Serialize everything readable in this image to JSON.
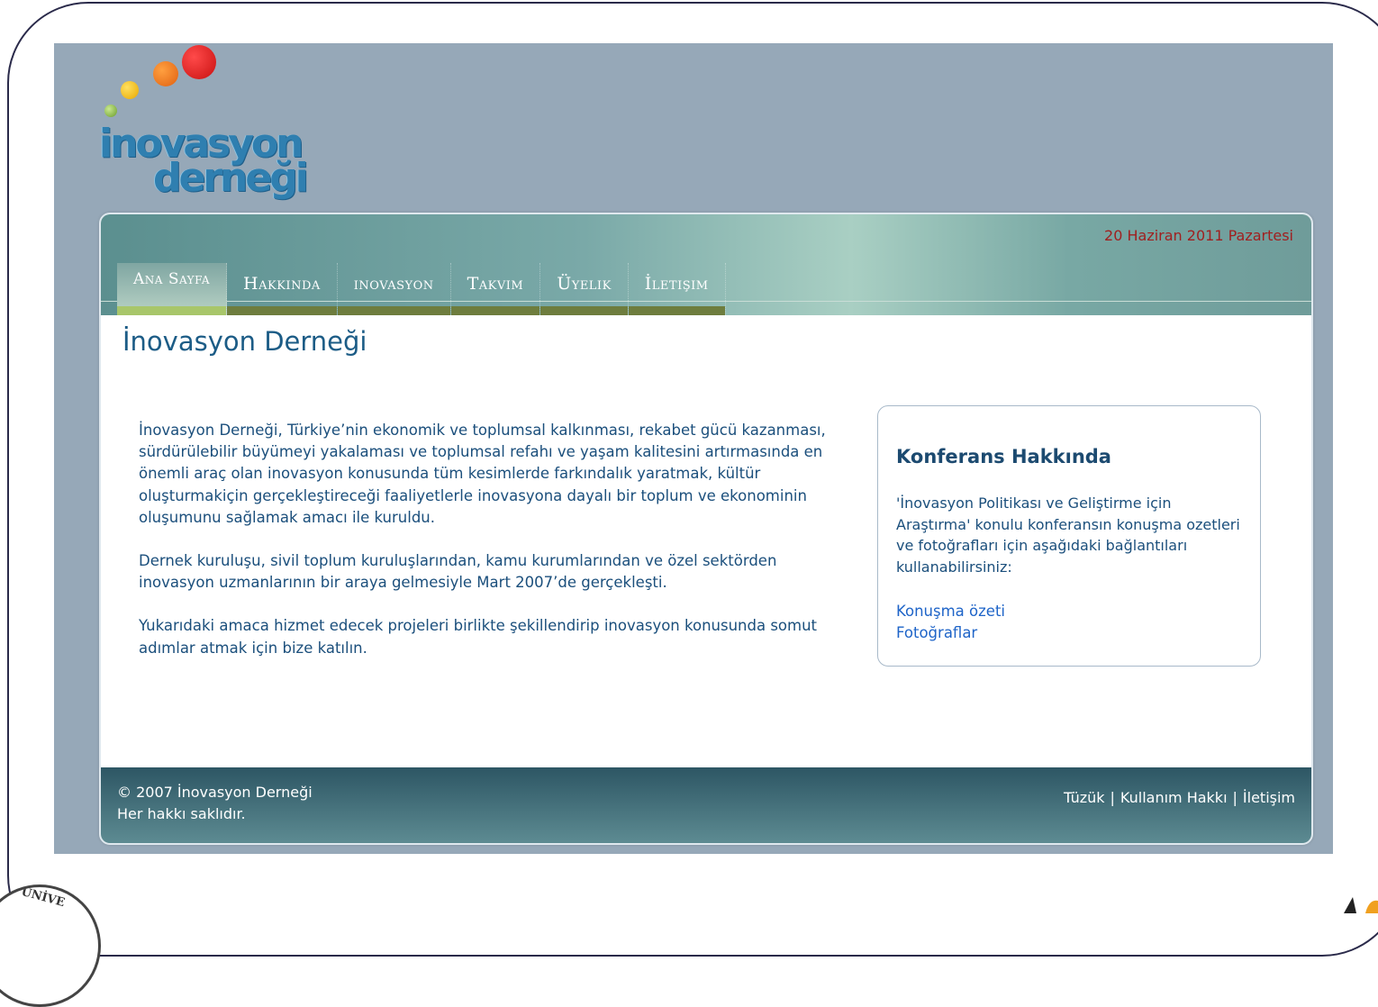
{
  "logo": {
    "line1": "inovasyon",
    "line2": "derneği"
  },
  "header": {
    "date": "20 Haziran 2011 Pazartesi"
  },
  "nav": {
    "items": [
      {
        "label": "Ana Sayfa",
        "active": true
      },
      {
        "label": "Hakkında",
        "active": false
      },
      {
        "label": "inovasyon",
        "active": false
      },
      {
        "label": "Takvim",
        "active": false
      },
      {
        "label": "Üyelik",
        "active": false
      },
      {
        "label": "İletişim",
        "active": false
      }
    ]
  },
  "page": {
    "title": "İnovasyon Derneği"
  },
  "content": {
    "p1": "İnovasyon Derneği, Türkiye’nin ekonomik ve toplumsal kalkınması, rekabet gücü kazanması, sürdürülebilir büyümeyi yakalaması ve toplumsal refahı ve yaşam kalitesini artırmasında en önemli araç olan inovasyon konusunda tüm kesimlerde farkındalık yaratmak, kültür oluşturmakiçin gerçekleştireceği faaliyetlerle inovasyona dayalı bir toplum ve ekonominin oluşumunu sağlamak amacı ile kuruldu.",
    "p2": "Dernek kuruluşu, sivil toplum kuruluşlarından, kamu kurumlarından ve özel sektörden inovasyon uzmanlarının bir araya gelmesiyle Mart 2007’de gerçekleşti.",
    "p3": "Yukarıdaki amaca hizmet edecek projeleri birlikte şekillendirip inovasyon konusunda somut adımlar atmak için bize katılın."
  },
  "sidebox": {
    "title": "Konferans Hakkında",
    "desc": "'İnovasyon Politikası ve Geliştirme için Araştırma' konulu konferansın konuşma ozetleri ve fotoğrafları için aşağıdaki bağlantıları kullanabilirsiniz:",
    "link1": "Konuşma özeti",
    "link2": "Fotoğraflar"
  },
  "footer": {
    "copyright": "© 2007 İnovasyon Derneği",
    "rights": "Her hakkı saklıdır.",
    "links": [
      "Tüzük",
      "Kullanım Hakkı",
      "İletişim"
    ],
    "separator": "|"
  },
  "corner": {
    "university_text": "ÜNİVE"
  },
  "colors": {
    "background": "#96a8b8",
    "title": "#1c5c86",
    "date": "#a02020",
    "link": "#1e64c8"
  }
}
